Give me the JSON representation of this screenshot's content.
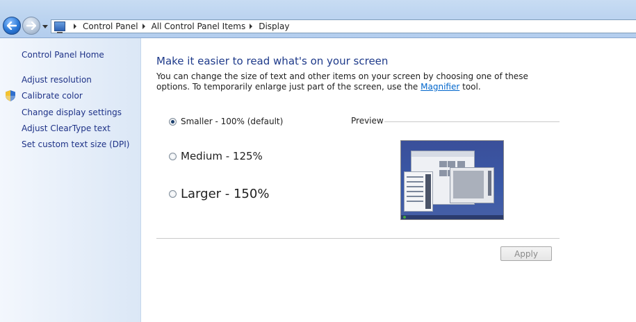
{
  "breadcrumb": {
    "items": [
      "Control Panel",
      "All Control Panel Items",
      "Display"
    ]
  },
  "sidebar": {
    "home": "Control Panel Home",
    "links": [
      {
        "label": "Adjust resolution",
        "icon": ""
      },
      {
        "label": "Calibrate color",
        "icon": "shield-icon"
      },
      {
        "label": "Change display settings",
        "icon": ""
      },
      {
        "label": "Adjust ClearType text",
        "icon": ""
      },
      {
        "label": "Set custom text size (DPI)",
        "icon": ""
      }
    ]
  },
  "main": {
    "title": "Make it easier to read what's on your screen",
    "description_pre": "You can change the size of text and other items on your screen by choosing one of these options. To temporarily enlarge just part of the screen, use the",
    "magnifier_link": "Magnifier",
    "description_post": "tool.",
    "options": [
      {
        "label": "Smaller - 100% (default)",
        "checked": true
      },
      {
        "label": "Medium - 125%",
        "checked": false
      },
      {
        "label": "Larger - 150%",
        "checked": false
      }
    ],
    "preview_label": "Preview",
    "apply_label": "Apply"
  },
  "colors": {
    "link": "#1e3287",
    "title": "#1e3a8a",
    "accent": "#2b78d6"
  }
}
